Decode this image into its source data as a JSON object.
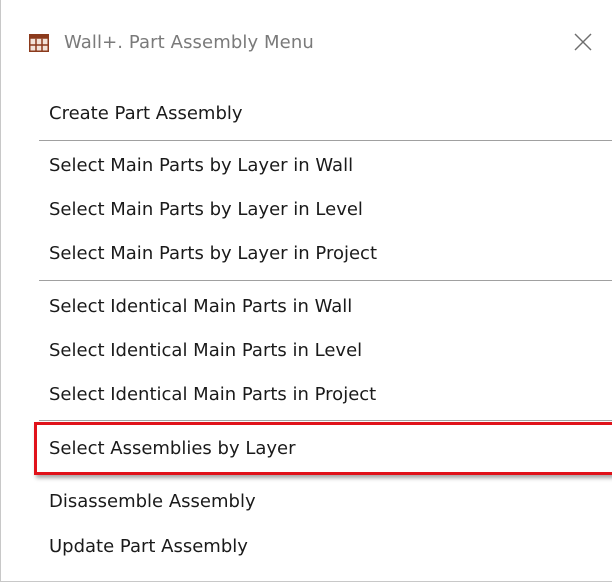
{
  "window": {
    "title": "Wall+. Part Assembly Menu",
    "icon": "grid-window-icon",
    "close_icon": "close-icon"
  },
  "menu": {
    "groups": [
      {
        "items": [
          {
            "label": "Create Part Assembly"
          }
        ]
      },
      {
        "items": [
          {
            "label": "Select Main Parts by Layer in Wall"
          },
          {
            "label": "Select Main Parts by Layer in Level"
          },
          {
            "label": "Select Main Parts by Layer in Project"
          }
        ]
      },
      {
        "items": [
          {
            "label": "Select Identical Main Parts in Wall"
          },
          {
            "label": "Select Identical Main Parts in Level"
          },
          {
            "label": "Select Identical Main Parts in Project"
          }
        ]
      },
      {
        "items": [
          {
            "label": "Select Assemblies by Layer",
            "highlighted": true
          }
        ]
      },
      {
        "items": [
          {
            "label": "Disassemble Assembly"
          },
          {
            "label": "Update Part Assembly"
          }
        ]
      }
    ]
  },
  "colors": {
    "highlight_border": "#e0121a",
    "icon_brown": "#8b3a1c"
  }
}
